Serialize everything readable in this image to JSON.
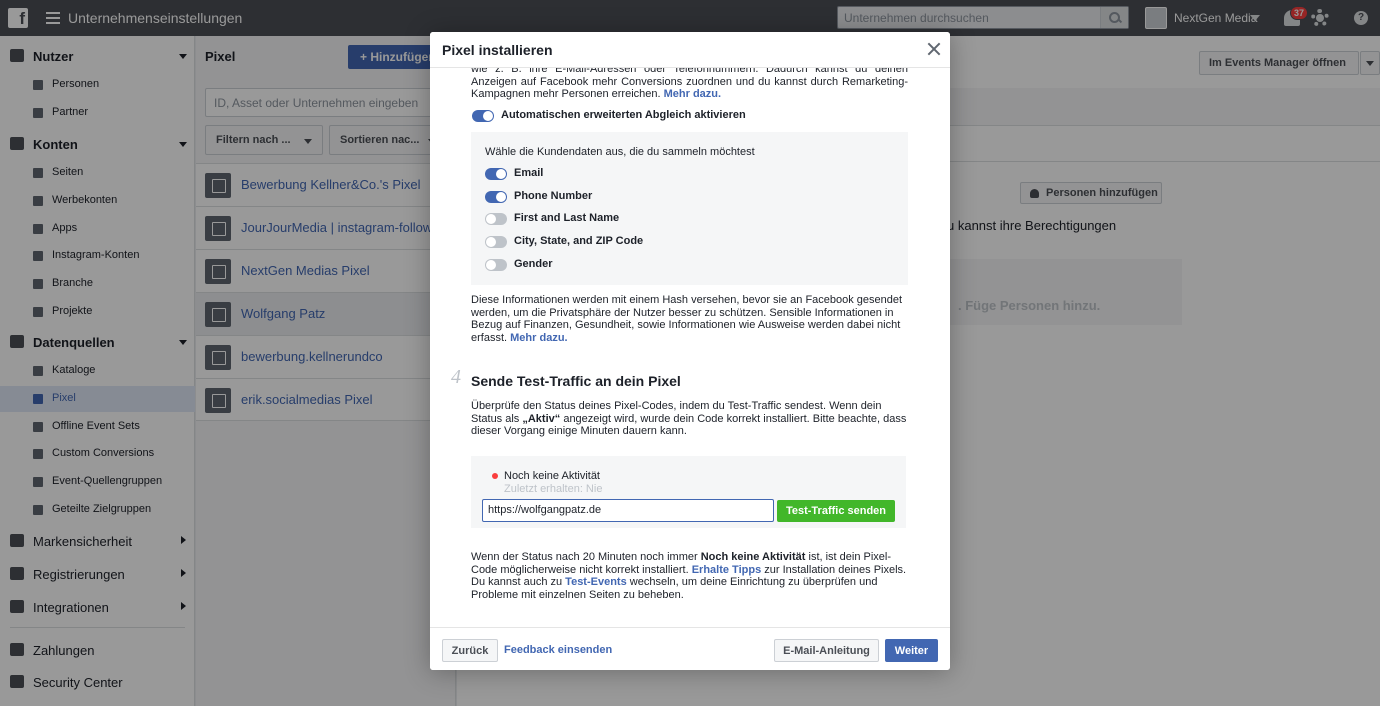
{
  "topbar": {
    "title": "Unternehmenseinstellungen",
    "search_placeholder": "Unternehmen durchsuchen",
    "business_name": "NextGen Media",
    "notification_count": "37"
  },
  "sidebar": {
    "sections": [
      {
        "label": "Nutzer",
        "items": [
          "Personen",
          "Partner"
        ]
      },
      {
        "label": "Konten",
        "items": [
          "Seiten",
          "Werbekonten",
          "Apps",
          "Instagram-Konten",
          "Branche",
          "Projekte"
        ]
      },
      {
        "label": "Datenquellen",
        "items": [
          "Kataloge",
          "Pixel",
          "Offline Event Sets",
          "Custom Conversions",
          "Event-Quellengruppen",
          "Geteilte Zielgruppen"
        ]
      }
    ],
    "collapsed": [
      "Markensicherheit",
      "Registrierungen",
      "Integrationen"
    ],
    "bottom": [
      "Zahlungen",
      "Security Center"
    ],
    "active_item": "Pixel"
  },
  "pixel_list": {
    "title": "Pixel",
    "add_button": "Hinzufügen",
    "search_placeholder": "ID, Asset oder Unternehmen eingeben",
    "filter_label": "Filtern nach ...",
    "sort_label": "Sortieren nac...",
    "items": [
      "Bewerbung Kellner&Co.'s Pixel",
      "JourJourMedia | instagram-follow-bot",
      "NextGen Medias Pixel",
      "Wolfgang Patz",
      "bewerbung.kellnerundco",
      "erik.socialmedias Pixel"
    ],
    "selected": "Wolfgang Patz"
  },
  "main": {
    "events_manager_button": "Im Events Manager öffnen",
    "add_people_button": "Personen hinzufügen",
    "partial_text": "u kannst ihre Berechtigungen",
    "empty_text": ". Füge Personen hinzu."
  },
  "modal": {
    "title": "Pixel installieren",
    "intro_text": "wie z. B. ihre E-Mail-Adressen oder Telefonnummern. Dadurch kannst du deinen Anzeigen auf Facebook mehr Conversions zuordnen und du kannst durch Remarketing-Kampagnen mehr Personen erreichen.",
    "more_link": "Mehr dazu.",
    "auto_match_label": "Automatischen erweiterten Abgleich aktivieren",
    "customer_data_prompt": "Wähle die Kundendaten aus, die du sammeln möchtest",
    "fields": [
      {
        "label": "Email",
        "on": true
      },
      {
        "label": "Phone Number",
        "on": true
      },
      {
        "label": "First and Last Name",
        "on": false
      },
      {
        "label": "City, State, and ZIP Code",
        "on": false
      },
      {
        "label": "Gender",
        "on": false
      }
    ],
    "hash_text": "Diese Informationen werden mit einem Hash versehen, bevor sie an Facebook gesendet werden, um die Privatsphäre der Nutzer besser zu schützen. Sensible Informationen in Bezug auf Finanzen, Gesundheit, sowie Informationen wie Ausweise werden dabei nicht erfasst.",
    "hash_link": "Mehr dazu.",
    "step_number": "4",
    "step_title": "Sende Test-Traffic an dein Pixel",
    "step_text_1": "Überprüfe den Status deines Pixel-Codes, indem du Test-Traffic sendest. Wenn dein Status als ",
    "step_text_bold": "„Aktiv“",
    "step_text_2": " angezeigt wird, wurde dein Code korrekt installiert. Bitte beachte, dass dieser Vorgang einige Minuten dauern kann.",
    "status_label": "Noch keine Aktivität",
    "last_received": "Zuletzt erhalten: Nie",
    "url_value": "https://wolfgangpatz.de",
    "send_button": "Test-Traffic senden",
    "bottom_1": "Wenn der Status nach 20 Minuten noch immer ",
    "bottom_bold": "Noch keine Aktivität",
    "bottom_2": " ist, ist dein Pixel-Code möglicherweise nicht korrekt installiert. ",
    "tips_link": "Erhalte Tipps",
    "bottom_3": " zur Installation deines Pixels. Du kannst auch zu ",
    "events_link": "Test-Events",
    "bottom_4": " wechseln, um deine Einrichtung zu überprüfen und Probleme mit einzelnen Seiten zu beheben.",
    "back_button": "Zurück",
    "feedback_link": "Feedback einsenden",
    "email_button": "E-Mail-Anleitung",
    "next_button": "Weiter"
  },
  "colors": {
    "accent": "#4267b2",
    "success": "#42b72a",
    "status_red": "#fa3e3e",
    "topbar": "#4b4f56"
  }
}
